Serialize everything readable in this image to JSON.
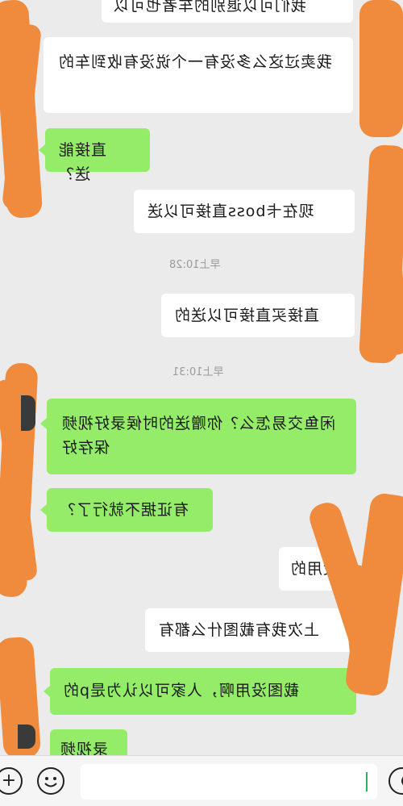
{
  "messages": [
    {
      "side": "white",
      "text": "我们可以退别的车者也可以"
    },
    {
      "side": "white",
      "text": "我卖过这么多没有一个说没有收到车的"
    },
    {
      "side": "green",
      "text": "直接能送？"
    },
    {
      "side": "white",
      "text": "现在卡boss直接可以送"
    },
    {
      "side": "white",
      "text": "直接买直接可以送的"
    },
    {
      "side": "green",
      "text": "闲鱼交易怎么？你赠送的时候录好视频保存好"
    },
    {
      "side": "green",
      "text": "有证据不就行了？"
    },
    {
      "side": "white",
      "text": "没用的"
    },
    {
      "side": "white",
      "text": "上次我有截图什么都有"
    },
    {
      "side": "green",
      "text": "截图没用啊，人家可以认为是p的"
    },
    {
      "side": "green",
      "text": "录视频"
    }
  ],
  "timestamps": [
    "早上10:28",
    "早上10:31"
  ],
  "bottom_bar": {
    "emoji_icon": "smiley-face-icon",
    "add_icon": "plus-circle-icon",
    "voice_icon": "voice-circle-icon"
  },
  "colors": {
    "green_bubble": "#95ec69",
    "white_bubble": "#ffffff",
    "background": "#ebebeb",
    "scribble": "#f08a3c"
  }
}
